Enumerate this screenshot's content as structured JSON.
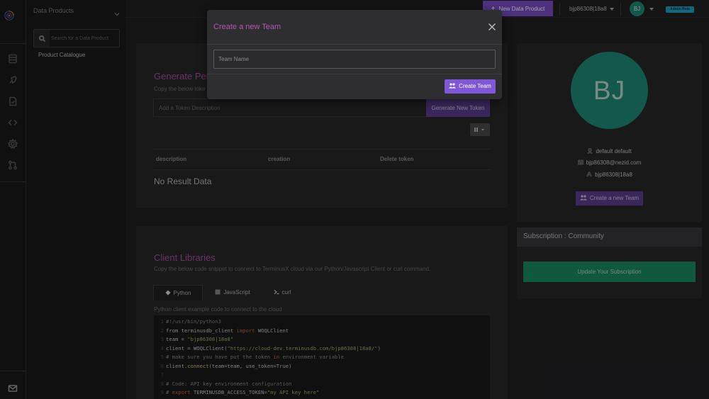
{
  "sidebar": {
    "title": "Data Products",
    "search_placeholder": "Search for a Data Product",
    "items": [
      "Product Catalogue"
    ]
  },
  "rail": {
    "icons": [
      "terminusx-logo-icon",
      "database-icon",
      "rocket-icon",
      "document-icon",
      "code-icon",
      "settings-icon",
      "merge-icon",
      "mail-icon"
    ]
  },
  "topbar": {
    "new_button": "New Data Product",
    "user": "bjp86308|18a8",
    "avatar": "BJ",
    "badge": "Admin Role"
  },
  "token": {
    "title": "Generate Per",
    "subtitle": "Copy the below toke",
    "input_placeholder": "Add a Token Description",
    "generate_button": "Generate New Token",
    "columns": [
      "description",
      "creation",
      "Delete token"
    ],
    "empty": "No Result Data"
  },
  "profile": {
    "initials": "BJ",
    "name": "default default",
    "email": "bjp86308@nezid.com",
    "username": "bjp86308|18a8",
    "team_button": "Create a new Team"
  },
  "subscription": {
    "title": "Subscription : Community",
    "button": "Update Your Subscription"
  },
  "clients": {
    "title": "Client Libraries",
    "subtitle": "Copy the below code snippet to connect to TerminusX cloud via our Python/Javascript Client or curl command.",
    "tabs": [
      "Python",
      "JavaScript",
      "curl"
    ],
    "caption": "Python client example code to connect to the cloud",
    "code": {
      "l1": "#!/usr/bin/python3",
      "l2a": "from terminusdb_client ",
      "l2b": "import",
      "l2c": " WOQLClient",
      "l3a": "team = ",
      "l3b": "\"bjp86308|18a8\"",
      "l4a": "client = WOQLClient(",
      "l4b": "\"https://cloud-dev.terminusdb.com/bjp86308|18a8/\"",
      "l4c": ")",
      "l5a": "# make sure you have put the token ",
      "l5b": "in",
      "l5c": " environment variable",
      "l6a": "client.",
      "l6b": "connect",
      "l6c": "(team=team, use_token=True)",
      "l8": "# Code: API key environment configuration",
      "l9a": "# ",
      "l9b": "export",
      "l9c": " TERMINUSDB_ACCESS_TOKEN=",
      "l9d": "\"my API key here\""
    }
  },
  "modal": {
    "title": "Create a new Team",
    "input_placeholder": "Team Name",
    "create_button": "Create Team"
  }
}
